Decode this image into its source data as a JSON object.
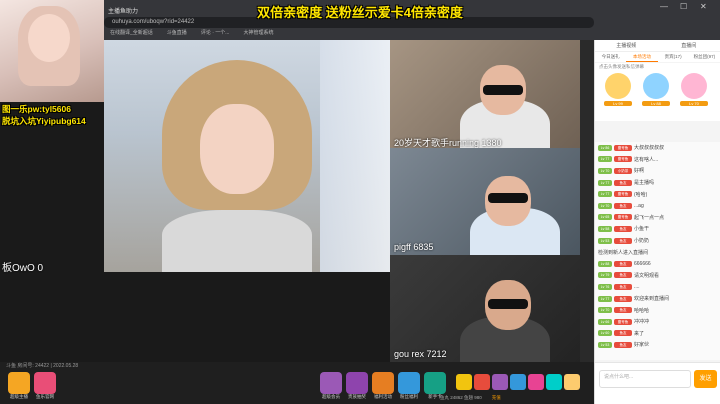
{
  "browser": {
    "tab_title": "主播鱼助力",
    "address": "ouhuya.com/uboqw?rid=24422",
    "bookmarks": [
      "在线翻译_全新超话",
      "斗鱼直播",
      "评论 · 一个...",
      "大神管理系统"
    ],
    "window_controls": [
      "—",
      "☐",
      "✕"
    ]
  },
  "stream": {
    "headline": "双倍亲密度 送粉丝示爱卡4倍亲密度",
    "overlay_promo": "图一乐pw:tyl5606",
    "overlay_rule": "脱坑入坑Yiyipubg614",
    "main_cam_label": "板OwO 0",
    "cam1_label": "20岁天才歌手running 1380",
    "cam2_label": "pigff 6835",
    "cam3_label": "gou rex 7212",
    "room_info": "斗鱼 房间号: 24422 | 2022.05.28"
  },
  "footer": {
    "left_buttons": [
      "超级主播",
      "鱼乐官网"
    ],
    "mid_buttons": [
      "超级会员",
      "贵族抽奖",
      "福利活动",
      "粉丝福利",
      "新手卡"
    ],
    "status": "鱼丸 24862  鱼翅 980",
    "recharge": "充值"
  },
  "sidebar": {
    "top_tabs": [
      "主播视频",
      "直播间"
    ],
    "sub_tabs": [
      "今日送礼",
      "本场活动",
      "贵宾(17)",
      "粉丝团(97)"
    ],
    "rank_hint": "点击头像发送私信弹幕",
    "rank_level": [
      "Lv 99",
      "Lv 88",
      "Lv 70"
    ],
    "chat": [
      {
        "badge": "Lv 86",
        "name": "壹号鱼",
        "text": "大叔叔叔叔叔"
      },
      {
        "badge": "Lv 77",
        "name": "壹号鱼",
        "text": "这有啥人..."
      },
      {
        "badge": "Lv 70",
        "name": "小奶茶",
        "text": "好啊"
      },
      {
        "badge": "Lv 77",
        "name": "鱼友",
        "text": "是主播吗"
      },
      {
        "badge": "Lv 77",
        "name": "壹号鱼",
        "text": "(哈哈)"
      },
      {
        "badge": "Lv 70",
        "name": "鱼友",
        "text": "...ag"
      },
      {
        "badge": "Lv 65",
        "name": "壹号鱼",
        "text": "起飞一点一点"
      },
      {
        "badge": "Lv 58",
        "name": "鱼友",
        "text": "小鱼干"
      },
      {
        "badge": "Lv 53",
        "name": "鱼友",
        "text": "小奶奶"
      },
      {
        "badge": "",
        "name": "",
        "text": "检测到新人进入直播间"
      },
      {
        "badge": "Lv 88",
        "name": "鱼友",
        "text": "666666"
      },
      {
        "badge": "Lv 79",
        "name": "鱼友",
        "text": "请文明观看"
      },
      {
        "badge": "Lv 76",
        "name": "鱼友",
        "text": "...."
      },
      {
        "badge": "Lv 77",
        "name": "鱼友",
        "text": "欢迎来到直播间"
      },
      {
        "badge": "Lv 70",
        "name": "鱼友",
        "text": "哈哈哈"
      },
      {
        "badge": "Lv 66",
        "name": "壹号鱼",
        "text": "冲冲冲"
      },
      {
        "badge": "Lv 60",
        "name": "鱼友",
        "text": "来了"
      },
      {
        "badge": "Lv 53",
        "name": "鱼友",
        "text": "好家伙"
      }
    ],
    "input_placeholder": "说点什么吧...",
    "send_label": "发送"
  },
  "colors": {
    "headline": "#ffe600",
    "accent": "#ff7a00",
    "send": "#ff9f00"
  }
}
